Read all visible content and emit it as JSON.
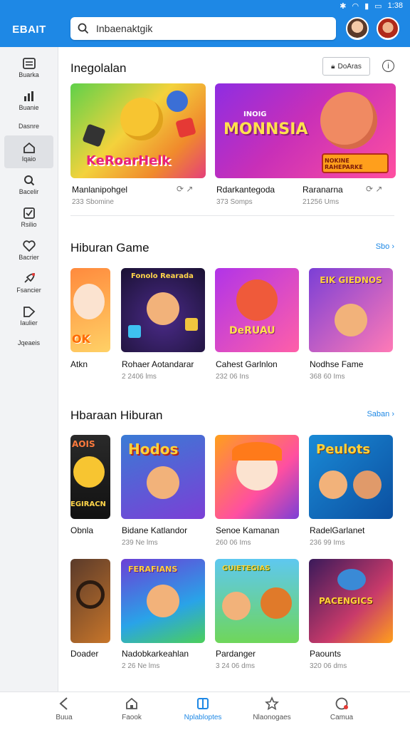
{
  "status": {
    "time": "1:38"
  },
  "app": {
    "logo": "EBAIT"
  },
  "search": {
    "value": "Inbaenaktgik"
  },
  "sidebar": {
    "items": [
      {
        "label": "Buarka",
        "icon": "list-icon"
      },
      {
        "label": "Buanie",
        "icon": "chart-icon"
      },
      {
        "label": "Dasnre",
        "icon": "blank-icon"
      },
      {
        "label": "Iqaio",
        "icon": "home-icon"
      },
      {
        "label": "Bacelir",
        "icon": "search-icon"
      },
      {
        "label": "Rsilio",
        "icon": "checkbox-icon"
      },
      {
        "label": "Bacrier",
        "icon": "heart-icon"
      },
      {
        "label": "Fsancier",
        "icon": "rocket-icon"
      },
      {
        "label": "Iaulier",
        "icon": "tag-icon"
      },
      {
        "label": "Jqeaeis",
        "icon": "blank-icon"
      }
    ]
  },
  "featured": {
    "title": "Inegolalan",
    "button": "DoAras",
    "more": "i",
    "items": [
      {
        "art": "KeRoarHelk",
        "name": "Manlanipohgel",
        "sub": "233 Sbomine"
      },
      {
        "art_top": "INOIG",
        "art": "MONNSIA",
        "art_badge": "NOKINE RAHEPARKE",
        "name": "Rdarkantegoda",
        "sub": "373 Somps"
      },
      {
        "name": "Raranarna",
        "sub": "21256 Ums"
      }
    ]
  },
  "section1": {
    "title": "Hiburan  Game",
    "see_all": "Sbo",
    "items": [
      {
        "art": "OK",
        "name": "Atkn",
        "sub": ""
      },
      {
        "art": "Fonolo Rearada",
        "name": "Rohaer Aotandarar",
        "sub": "2 2406 lms"
      },
      {
        "art": "DeRUAU",
        "name": "Cahest Garlnlon",
        "sub": "232 06 Ins"
      },
      {
        "art": "EIK GIEDNOS",
        "name": "Nodhse Fame",
        "sub": "368 60 Ims"
      }
    ]
  },
  "section2": {
    "title": "Hbaraan  Hiburan",
    "see_all": "Saban",
    "row1": [
      {
        "art": "AOIS",
        "art2": "EGIRACN",
        "name": "Obnla",
        "sub": ""
      },
      {
        "art": "Hodos",
        "name": "Bidane Katlandor",
        "sub": "239 Ne lms"
      },
      {
        "art": "",
        "name": "Senoe Kamanan",
        "sub": "260 06 Ims"
      },
      {
        "art": "Peulots",
        "name": "RadelGarlanet",
        "sub": "236 99 Ims"
      }
    ],
    "row2": [
      {
        "art": "",
        "name": "Doader",
        "sub": ""
      },
      {
        "art": "FERAFIANS",
        "name": "Nadobkarkeahlan",
        "sub": "2 26 Ne lms"
      },
      {
        "art": "GUIETEGIAS",
        "name": "Pardanger",
        "sub": "3 24 06 dms"
      },
      {
        "art": "PACENGICS",
        "name": "Paounts",
        "sub": "320 06 dms"
      }
    ]
  },
  "bottomnav": {
    "items": [
      {
        "label": "Buua",
        "icon": "back-arrow-icon"
      },
      {
        "label": "Faook",
        "icon": "home-icon"
      },
      {
        "label": "Nplabloptes",
        "icon": "book-icon"
      },
      {
        "label": "Nlaonogaes",
        "icon": "star-icon"
      },
      {
        "label": "Camua",
        "icon": "clock-icon"
      }
    ]
  },
  "colors": {
    "accent": "#1e88e5",
    "sidebar_bg": "#f2f3f5"
  }
}
